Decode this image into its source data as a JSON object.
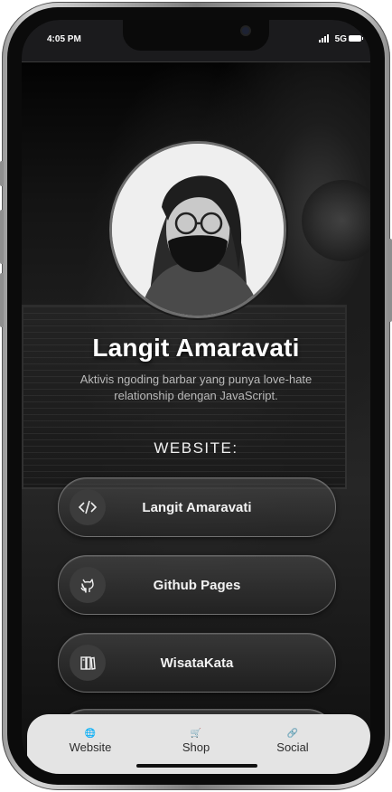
{
  "status_bar": {
    "time": "4:05 PM",
    "network": "5G",
    "signal_icon": "signal-bars-icon",
    "battery_icon": "battery-icon"
  },
  "profile": {
    "name": "Langit Amaravati",
    "bio": "Aktivis ngoding barbar yang punya love-hate relationship dengan JavaScript.",
    "avatar_icon": "profile-photo"
  },
  "section": {
    "title": "WEBSITE:"
  },
  "links": [
    {
      "label": "Langit Amaravati",
      "icon": "code-icon"
    },
    {
      "label": "Github Pages",
      "icon": "github-icon"
    },
    {
      "label": "WisataKata",
      "icon": "books-icon"
    }
  ],
  "bottom_nav": {
    "items": [
      {
        "label": "Website",
        "icon": "globe-icon",
        "glyph": "🌐"
      },
      {
        "label": "Shop",
        "icon": "cart-icon",
        "glyph": "🛒"
      },
      {
        "label": "Social",
        "icon": "link-icon",
        "glyph": "🔗"
      }
    ]
  },
  "colors": {
    "background": "#000000",
    "text_primary": "#ffffff",
    "text_secondary": "#b9b9b9",
    "nav_background": "#e4e4e4"
  }
}
